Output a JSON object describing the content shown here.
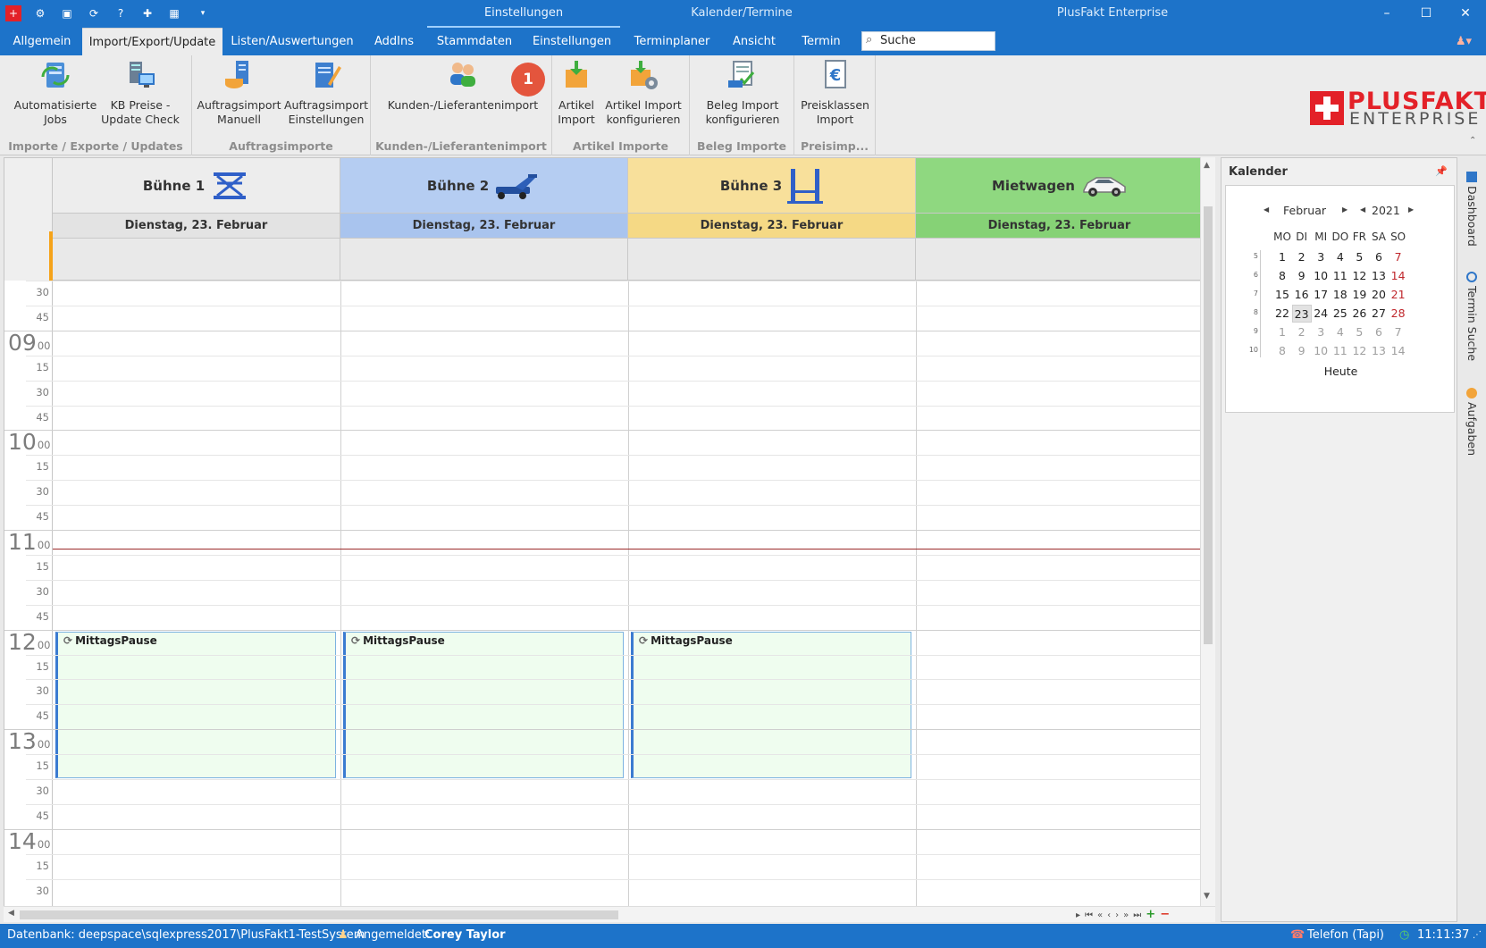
{
  "window": {
    "context_tab": "Einstellungen",
    "section": "Kalender/Termine",
    "app_title": "PlusFakt Enterprise",
    "controls": {
      "minimize": "–",
      "maximize": "☐",
      "close": "✕"
    }
  },
  "tabs": [
    "Allgemein",
    "Import/Export/Update",
    "Listen/Auswertungen",
    "AddIns",
    "Stammdaten",
    "Einstellungen",
    "Terminplaner",
    "Ansicht",
    "Termin"
  ],
  "active_tab": 1,
  "search": {
    "placeholder": "Suche"
  },
  "ribbon": {
    "groups": [
      {
        "caption": "Importe / Exporte / Updates",
        "buttons": [
          "Automatisierte\nJobs",
          "KB Preise -\nUpdate Check"
        ]
      },
      {
        "caption": "Auftragsimporte",
        "buttons": [
          "Auftragsimport\nManuell",
          "Auftragsimport\nEinstellungen"
        ]
      },
      {
        "caption": "Kunden-/Lieferantenimport",
        "buttons": [
          "Kunden-/Lieferantenimport"
        ],
        "badge": "1"
      },
      {
        "caption": "Artikel Importe",
        "buttons": [
          "Artikel\nImport",
          "Artikel Import\nkonfigurieren"
        ]
      },
      {
        "caption": "Beleg Importe",
        "buttons": [
          "Beleg Import\nkonfigurieren"
        ]
      },
      {
        "caption": "Preisimp...",
        "buttons": [
          "Preisklassen\nImport"
        ]
      }
    ],
    "logo": {
      "line1": "PLUSFAKT",
      "line2": "ENTERPRISE"
    }
  },
  "scheduler": {
    "resources": [
      {
        "name": "Bühne 1",
        "date": "Dienstag, 23. Februar",
        "color": "#ededed",
        "icon": "scissor-lift-icon"
      },
      {
        "name": "Bühne 2",
        "date": "Dienstag, 23. Februar",
        "color": "#b5cdf2",
        "icon": "floor-jack-icon"
      },
      {
        "name": "Bühne 3",
        "date": "Dienstag, 23. Februar",
        "color": "#f8e09b",
        "icon": "two-post-lift-icon"
      },
      {
        "name": "Mietwagen",
        "date": "Dienstag, 23. Februar",
        "color": "#8fd880",
        "icon": "car-icon"
      }
    ],
    "time_slots": [
      {
        "hour": "",
        "min": "30"
      },
      {
        "hour": "",
        "min": "45"
      },
      {
        "hour": "09",
        "min": "00"
      },
      {
        "hour": "",
        "min": "15"
      },
      {
        "hour": "",
        "min": "30"
      },
      {
        "hour": "",
        "min": "45"
      },
      {
        "hour": "10",
        "min": "00"
      },
      {
        "hour": "",
        "min": "15"
      },
      {
        "hour": "",
        "min": "30"
      },
      {
        "hour": "",
        "min": "45"
      },
      {
        "hour": "11",
        "min": "00"
      },
      {
        "hour": "",
        "min": "15"
      },
      {
        "hour": "",
        "min": "30"
      },
      {
        "hour": "",
        "min": "45"
      },
      {
        "hour": "12",
        "min": "00"
      },
      {
        "hour": "",
        "min": "15"
      },
      {
        "hour": "",
        "min": "30"
      },
      {
        "hour": "",
        "min": "45"
      },
      {
        "hour": "13",
        "min": "00"
      },
      {
        "hour": "",
        "min": "15"
      },
      {
        "hour": "",
        "min": "30"
      },
      {
        "hour": "",
        "min": "45"
      },
      {
        "hour": "14",
        "min": "00"
      },
      {
        "hour": "",
        "min": "15"
      },
      {
        "hour": "",
        "min": "30"
      }
    ],
    "appointments": [
      {
        "resource": 0,
        "title": "MittagsPause"
      },
      {
        "resource": 1,
        "title": "MittagsPause"
      },
      {
        "resource": 2,
        "title": "MittagsPause"
      }
    ]
  },
  "calendar": {
    "title": "Kalender",
    "month": "Februar",
    "year": "2021",
    "weekdays": [
      "MO",
      "DI",
      "MI",
      "DO",
      "FR",
      "SA",
      "SO"
    ],
    "weeks": [
      {
        "wk": "5",
        "days": [
          "1",
          "2",
          "3",
          "4",
          "5",
          "6",
          "7"
        ]
      },
      {
        "wk": "6",
        "days": [
          "8",
          "9",
          "10",
          "11",
          "12",
          "13",
          "14"
        ]
      },
      {
        "wk": "7",
        "days": [
          "15",
          "16",
          "17",
          "18",
          "19",
          "20",
          "21"
        ]
      },
      {
        "wk": "8",
        "days": [
          "22",
          "23",
          "24",
          "25",
          "26",
          "27",
          "28"
        ]
      },
      {
        "wk": "9",
        "days": [
          "1",
          "2",
          "3",
          "4",
          "5",
          "6",
          "7"
        ]
      },
      {
        "wk": "10",
        "days": [
          "8",
          "9",
          "10",
          "11",
          "12",
          "13",
          "14"
        ]
      }
    ],
    "selected": "23",
    "today_label": "Heute"
  },
  "side_tabs": [
    "Dashboard",
    "Termin Suche",
    "Aufgaben"
  ],
  "status": {
    "db_label": "Datenbank: deepspace\\sqlexpress2017\\PlusFakt1-TestSystem",
    "login_label": "Angemeldet:",
    "user": "Corey Taylor",
    "phone": "Telefon (Tapi)",
    "time": "11:11:37"
  }
}
